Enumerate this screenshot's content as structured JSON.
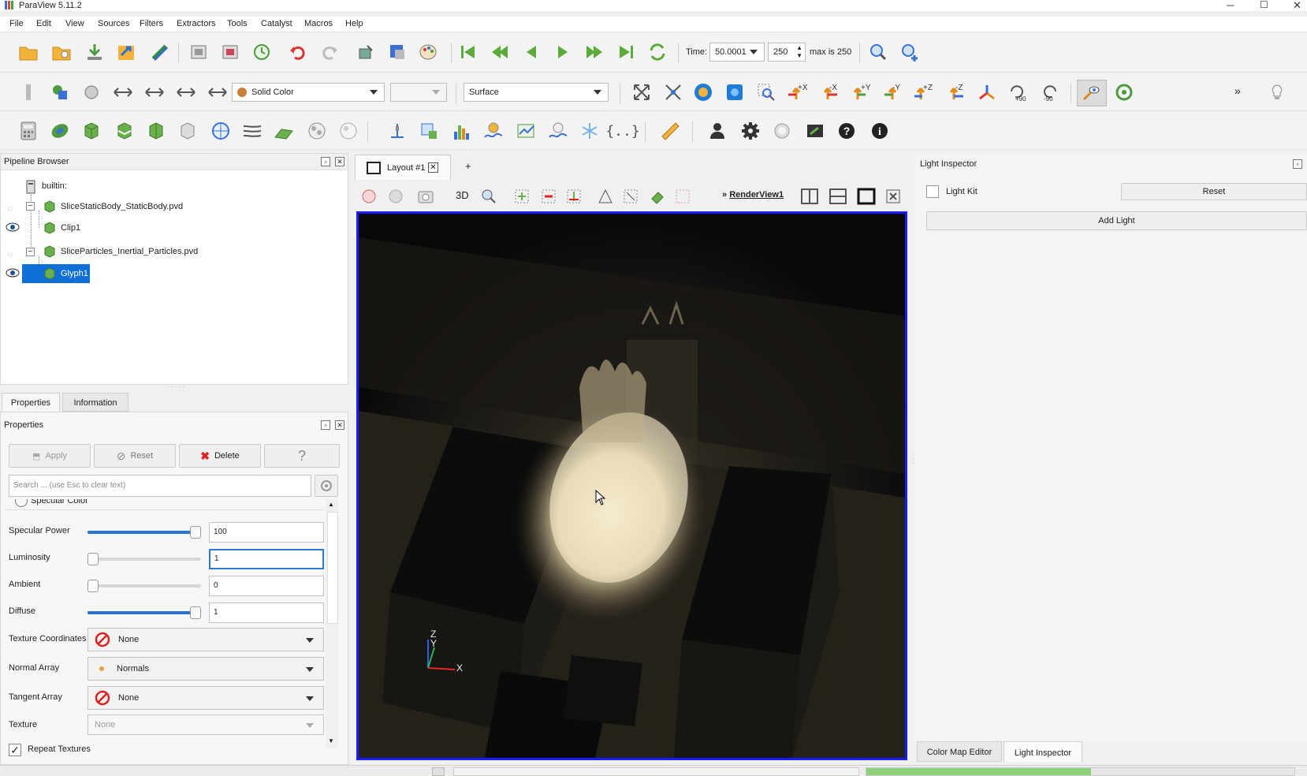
{
  "app": {
    "title": "ParaView 5.11.2"
  },
  "menu": [
    "File",
    "Edit",
    "View",
    "Sources",
    "Filters",
    "Extractors",
    "Tools",
    "Catalyst",
    "Macros",
    "Help"
  ],
  "toolbar1": {
    "time_label": "Time:",
    "time_value": "50.0001",
    "timestep_value": "250",
    "max_label": "max is 250"
  },
  "toolbar2": {
    "coloring_value": "Solid Color",
    "component_value": "",
    "representation_value": "Surface"
  },
  "pipeline": {
    "title": "Pipeline Browser",
    "items": [
      {
        "label": "builtin:"
      },
      {
        "label": "SliceStaticBody_StaticBody.pvd"
      },
      {
        "label": "Clip1"
      },
      {
        "label": "SliceParticles_Inertial_Particles.pvd"
      },
      {
        "label": "Glyph1"
      }
    ]
  },
  "tabs": {
    "properties": "Properties",
    "information": "Information"
  },
  "properties": {
    "title": "Properties",
    "apply": "Apply",
    "reset": "Reset",
    "delete": "Delete",
    "help": "?",
    "search_placeholder": "Search ... (use Esc to clear text)",
    "partial_label": "Specular Color",
    "rows": {
      "specular_power": {
        "label": "Specular Power",
        "value": "100",
        "slider_fraction": 1.0
      },
      "luminosity": {
        "label": "Luminosity",
        "value": "1",
        "slider_fraction": 0.0
      },
      "ambient": {
        "label": "Ambient",
        "value": "0",
        "slider_fraction": 0.0
      },
      "diffuse": {
        "label": "Diffuse",
        "value": "1",
        "slider_fraction": 1.0
      }
    },
    "texture_coordinates": {
      "label": "Texture Coordinates",
      "value": "None"
    },
    "normal_array": {
      "label": "Normal Array",
      "value": "Normals"
    },
    "tangent_array": {
      "label": "Tangent Array",
      "value": "None"
    },
    "texture": {
      "label": "Texture",
      "value": "None"
    },
    "repeat_textures": {
      "label": "Repeat Textures",
      "checked": true
    }
  },
  "layout": {
    "tab_label": "Layout #1",
    "add_tab": "+",
    "mode_3d": "3D",
    "render_view": "RenderView1",
    "axes": {
      "z": "Z",
      "y": "Y",
      "x": "X"
    }
  },
  "light_inspector": {
    "title": "Light Inspector",
    "light_kit": "Light Kit",
    "reset": "Reset",
    "add_light": "Add Light"
  },
  "bottom_tabs": {
    "color_map_editor": "Color Map Editor",
    "light_inspector": "Light Inspector"
  },
  "colors": {
    "accent": "#1e78e6",
    "selection": "#0f6fd6",
    "viewport_border": "#1a1aff"
  }
}
